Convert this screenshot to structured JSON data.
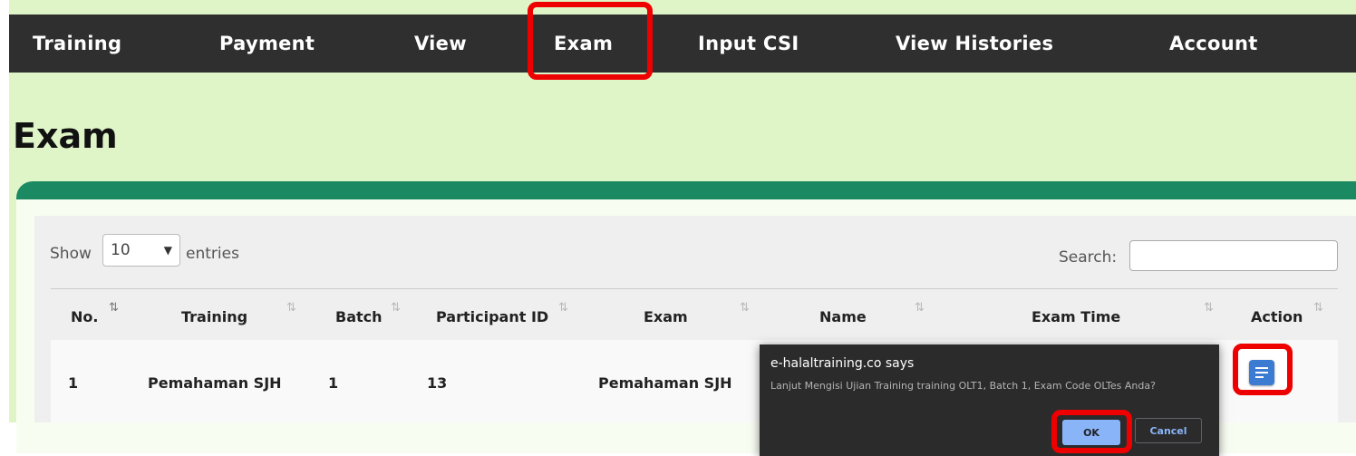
{
  "nav": {
    "items": [
      {
        "label": "Training"
      },
      {
        "label": "Payment"
      },
      {
        "label": "View"
      },
      {
        "label": "Exam"
      },
      {
        "label": "Input CSI"
      },
      {
        "label": "View Histories"
      },
      {
        "label": "Account"
      }
    ],
    "active": "Exam"
  },
  "page": {
    "title": "Exam"
  },
  "table_controls": {
    "show_label": "Show",
    "entries_value": "10",
    "entries_label": "entries",
    "search_label": "Search:",
    "search_value": ""
  },
  "table": {
    "columns": [
      "No.",
      "Training",
      "Batch",
      "Participant ID",
      "Exam",
      "Name",
      "Exam Time",
      "Action"
    ],
    "rows": [
      {
        "no": "1",
        "training": "Pemahaman SJH",
        "batch": "1",
        "participant_id": "13",
        "exam": "Pemahaman SJH",
        "name": "",
        "exam_time": ""
      }
    ]
  },
  "dialog": {
    "title": "e-halaltraining.co says",
    "message": "Lanjut Mengisi Ujian Training training OLT1, Batch 1, Exam Code OLTes Anda?",
    "ok_label": "OK",
    "cancel_label": "Cancel"
  },
  "icons": {
    "sort": "sort-arrows-icon",
    "sort_active": "sort-asc-icon",
    "action": "document-icon",
    "select": "chevron-down-icon"
  },
  "colors": {
    "navbar": "#2f2f2f",
    "page_background": "#dff5c8",
    "card_accent": "#1b8a63",
    "highlight": "#ee0000",
    "action_button": "#3b7bd1",
    "dialog_background": "#2b2b2b",
    "ok_button": "#8ab4f8"
  }
}
